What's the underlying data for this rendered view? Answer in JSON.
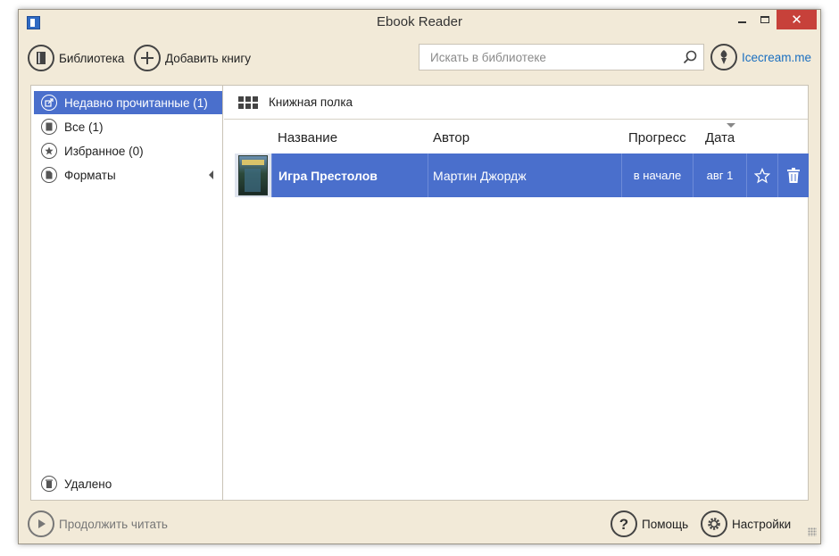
{
  "window": {
    "title": "Ebook Reader"
  },
  "toolbar": {
    "library_label": "Библиотека",
    "add_book_label": "Добавить книгу",
    "search_placeholder": "Искать в библиотеке",
    "brand_label": "Icecream.me"
  },
  "sidebar": {
    "items": [
      {
        "label": "Недавно прочитанные (1)",
        "icon": "share-icon",
        "active": true
      },
      {
        "label": "Все (1)",
        "icon": "book-icon"
      },
      {
        "label": "Избранное (0)",
        "icon": "star-icon"
      },
      {
        "label": "Форматы",
        "icon": "document-icon",
        "expandable": true
      }
    ],
    "trash_label": "Удалено"
  },
  "main": {
    "view_label": "Книжная полка",
    "columns": [
      "Название",
      "Автор",
      "Прогресс",
      "Дата"
    ],
    "rows": [
      {
        "title": "Игра Престолов",
        "author": "Мартин Джордж",
        "progress": "в начале",
        "date": "авг 1"
      }
    ]
  },
  "statusbar": {
    "continue_label": "Продолжить читать",
    "help_label": "Помощь",
    "settings_label": "Настройки"
  },
  "colors": {
    "selection": "#4a6fcc",
    "link": "#1a6fc0",
    "window_bg": "#f2ead8",
    "close": "#c7413a"
  }
}
